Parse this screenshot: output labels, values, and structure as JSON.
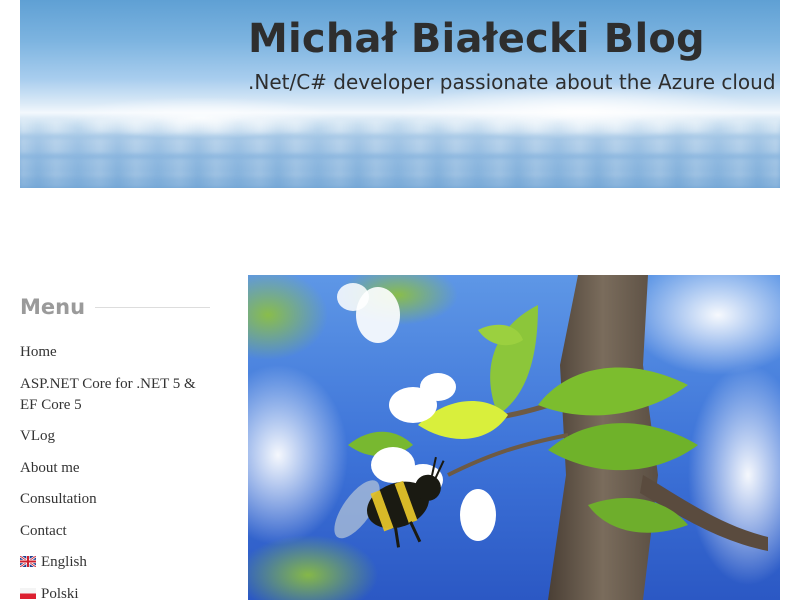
{
  "header": {
    "title": "Michał Białecki Blog",
    "tagline": ".Net/C# developer passionate about the Azure cloud"
  },
  "sidebar": {
    "widget_title": "Menu",
    "items": [
      {
        "label": "Home"
      },
      {
        "label": "ASP.NET Core for .NET 5 & EF Core 5"
      },
      {
        "label": "VLog"
      },
      {
        "label": "About me"
      },
      {
        "label": "Consultation"
      },
      {
        "label": "Contact"
      },
      {
        "label": "English",
        "icon": "uk-flag-icon"
      },
      {
        "label": "Polski",
        "icon": "poland-flag-icon"
      }
    ]
  },
  "featured_image": {
    "subject": "bee-on-apple-blossom-photo"
  },
  "colors": {
    "text": "#333333",
    "widget_title": "#9a9a9a",
    "sky": "#7db4e0"
  }
}
